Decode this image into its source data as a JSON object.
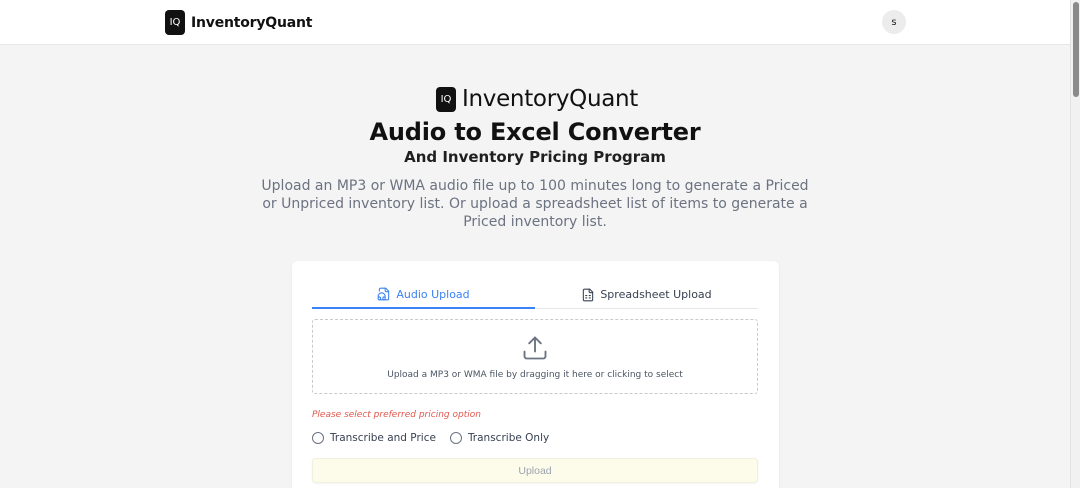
{
  "header": {
    "logo_text": "IQ",
    "brand_name": "InventoryQuant",
    "avatar_initial": "s"
  },
  "hero": {
    "logo_text": "IQ",
    "brand_name": "InventoryQuant",
    "title": "Audio to Excel Converter",
    "subtitle": "And Inventory Pricing Program",
    "description": "Upload an MP3 or WMA audio file up to 100 minutes long to generate a Priced or Unpriced inventory list. Or upload a spreadsheet list of items to generate a Priced inventory list."
  },
  "tabs": [
    {
      "label": "Audio Upload",
      "icon": "audio-file-icon",
      "active": true
    },
    {
      "label": "Spreadsheet Upload",
      "icon": "spreadsheet-file-icon",
      "active": false
    }
  ],
  "dropzone": {
    "icon": "upload-icon",
    "text": "Upload a MP3 or WMA file by dragging it here or clicking to select"
  },
  "warning": "Please select preferred pricing option",
  "pricing_options": [
    {
      "label": "Transcribe and Price",
      "selected": false
    },
    {
      "label": "Transcribe Only",
      "selected": false
    }
  ],
  "upload_button": "Upload",
  "colors": {
    "accent": "#3b82f6",
    "warning": "#e0584e",
    "logo_bg": "#111111",
    "upload_button_bg": "#fdfbe9"
  }
}
